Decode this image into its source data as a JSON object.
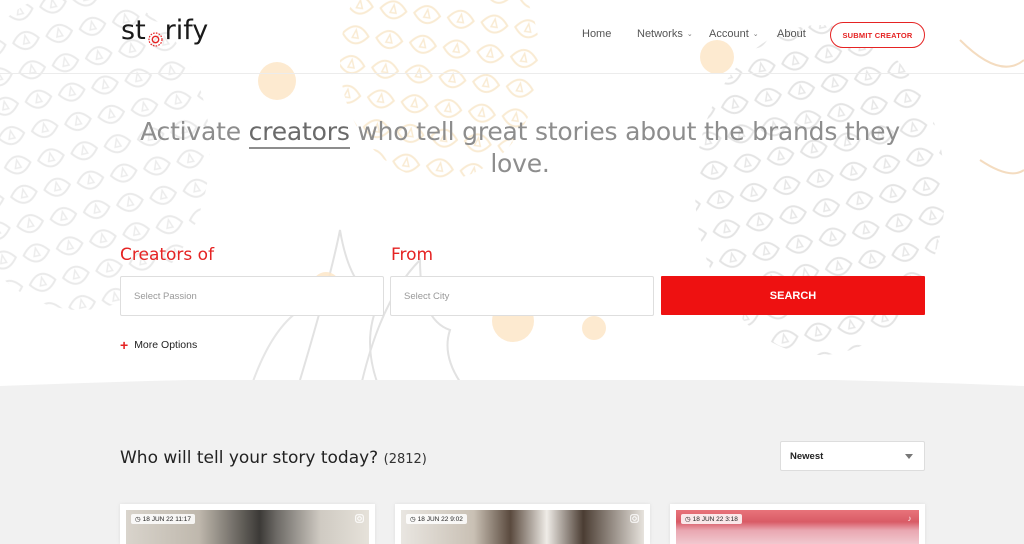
{
  "brand": {
    "logo_text_prefix": "st",
    "logo_text_suffix": "rify",
    "accent_color": "#e52323"
  },
  "nav": {
    "items": [
      {
        "label": "Home",
        "has_dropdown": false
      },
      {
        "label": "Networks",
        "has_dropdown": true
      },
      {
        "label": "Account",
        "has_dropdown": true
      },
      {
        "label": "About",
        "has_dropdown": false
      }
    ],
    "submit_label": "SUBMIT CREATOR"
  },
  "hero": {
    "title_before": "Activate ",
    "title_highlight": "creators",
    "title_after": " who tell great stories about the brands they love."
  },
  "search": {
    "creators_label": "Creators of",
    "from_label": "From",
    "passion_placeholder": "Select Passion",
    "city_placeholder": "Select City",
    "button_label": "SEARCH",
    "more_options_label": "More Options"
  },
  "listing": {
    "title": "Who will tell your story today?",
    "count": "(2812)",
    "sort_selected": "Newest",
    "cards": [
      {
        "date": "18 JUN 22 11:17",
        "network_icon": "instagram-icon"
      },
      {
        "date": "18 JUN 22 9:02",
        "network_icon": "instagram-icon"
      },
      {
        "date": "18 JUN 22 3:18",
        "network_icon": "tiktok-icon"
      }
    ]
  }
}
